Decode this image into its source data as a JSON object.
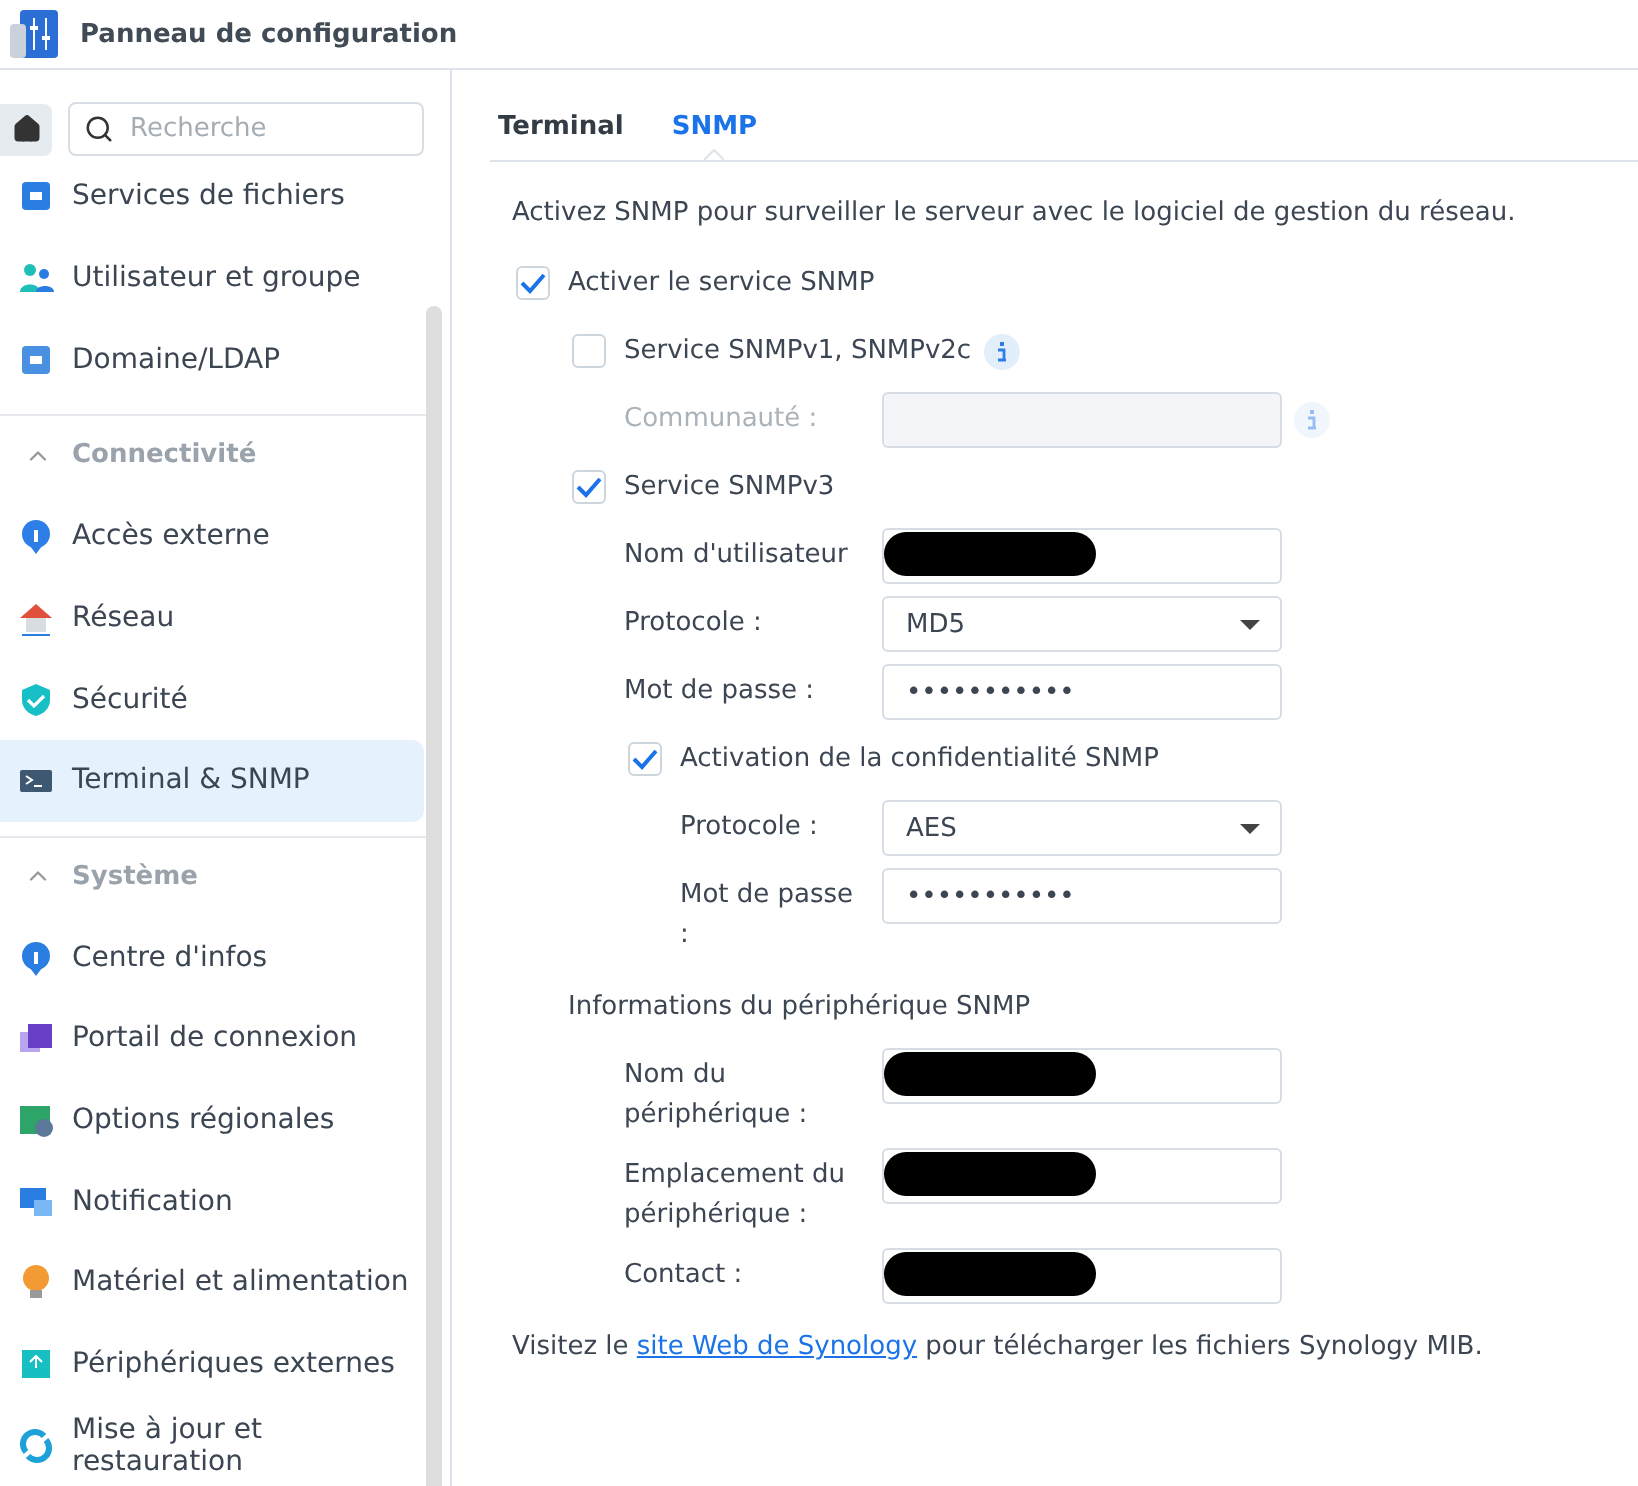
{
  "window": {
    "title": "Panneau de configuration"
  },
  "sidebar": {
    "search": {
      "placeholder": "Recherche"
    },
    "sections": [
      {
        "items": [
          {
            "label": "Services de fichiers",
            "selected": false
          },
          {
            "label": "Utilisateur et groupe",
            "selected": false
          },
          {
            "label": "Domaine/LDAP",
            "selected": false
          }
        ]
      },
      {
        "title": "Connectivité",
        "expanded": true,
        "items": [
          {
            "label": "Accès externe",
            "selected": false
          },
          {
            "label": "Réseau",
            "selected": false
          },
          {
            "label": "Sécurité",
            "selected": false
          },
          {
            "label": "Terminal & SNMP",
            "selected": true
          }
        ]
      },
      {
        "title": "Système",
        "expanded": true,
        "items": [
          {
            "label": "Centre d'infos",
            "selected": false
          },
          {
            "label": "Portail de connexion",
            "selected": false
          },
          {
            "label": "Options régionales",
            "selected": false
          },
          {
            "label": "Notification",
            "selected": false
          },
          {
            "label": "Matériel et alimentation",
            "selected": false
          },
          {
            "label": "Périphériques externes",
            "selected": false
          },
          {
            "label": "Mise à jour et restauration",
            "selected": false
          }
        ]
      }
    ]
  },
  "tabs": [
    {
      "label": "Terminal",
      "selected": false
    },
    {
      "label": "SNMP",
      "selected": true
    }
  ],
  "description": "Activez SNMP pour surveiller le serveur avec le logiciel de gestion du réseau.",
  "form": [
    {
      "kind": "checkbox",
      "label": "Activer le service SNMP",
      "checked": true,
      "children": [
        {
          "kind": "checkbox",
          "label": "Service SNMPv1, SNMPv2c",
          "checked": false,
          "info": true,
          "children": [
            {
              "kind": "text",
              "label": "Communauté :",
              "disabled": true,
              "info": true
            }
          ]
        },
        {
          "kind": "checkbox",
          "label": "Service SNMPv3",
          "checked": true,
          "children": [
            {
              "kind": "text",
              "label": "Nom d'utilisateur",
              "redacted": true
            },
            {
              "kind": "select",
              "label": "Protocole :",
              "value": "MD5"
            },
            {
              "kind": "password",
              "label": "Mot de passe :",
              "value": "•••••••••••"
            },
            {
              "kind": "checkbox",
              "label": "Activation de la confidentialité SNMP",
              "checked": true,
              "children": [
                {
                  "kind": "select",
                  "label": "Protocole :",
                  "value": "AES"
                },
                {
                  "kind": "password",
                  "label": "Mot de passe :",
                  "value": "•••••••••••"
                }
              ]
            }
          ]
        },
        {
          "kind": "heading",
          "label": "Informations du périphérique SNMP",
          "children": [
            {
              "kind": "text",
              "label": "Nom du périphérique :",
              "redacted": true
            },
            {
              "kind": "text",
              "label": "Emplacement du périphérique :",
              "redacted": true
            },
            {
              "kind": "text",
              "label": "Contact :",
              "redacted": true
            }
          ]
        }
      ]
    }
  ],
  "footer": {
    "before": "Visitez le",
    "link": "site Web de Synology",
    "after": "pour télécharger les fichiers Synology MIB."
  }
}
